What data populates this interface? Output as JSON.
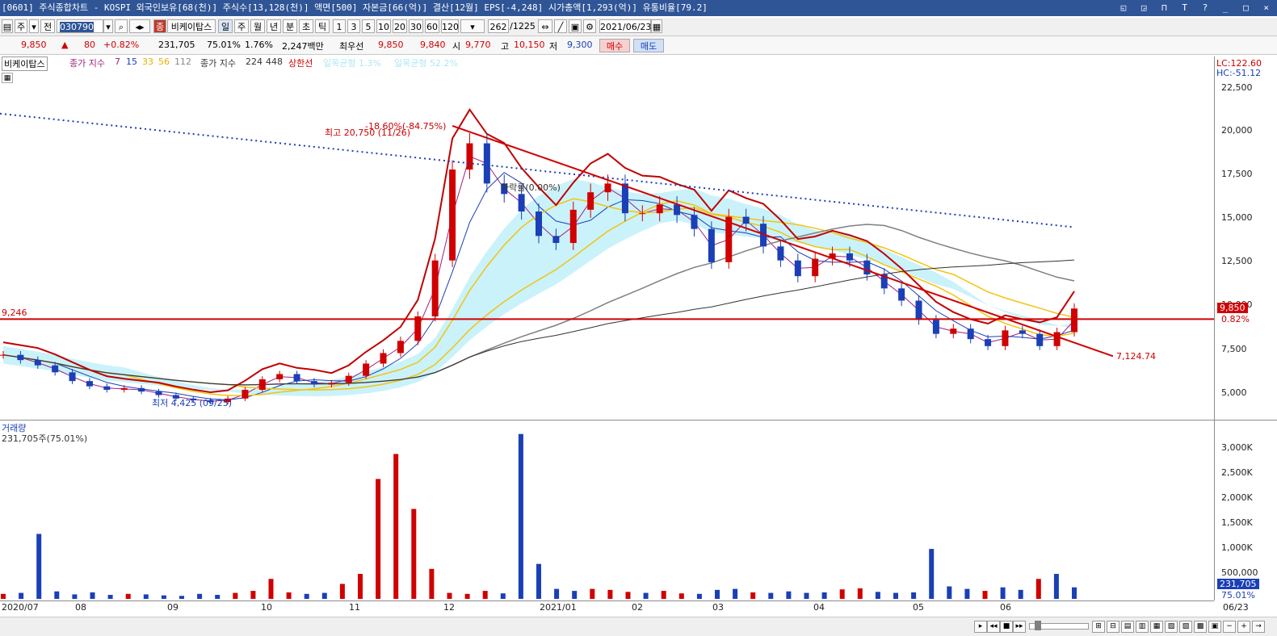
{
  "title": "[0601] 주식종합차트 - KOSPI 외국인보유[68(천)] 주식수[13,128(천)] 액면[500] 자본금[66(억)] 결산[12월] EPS[-4,248] 시가총액[1,293(억)] 유통비율[79.2]",
  "window_buttons": "◱ ◲ ⊓ T ? _ □ ×",
  "toolbar": {
    "code": "030790",
    "period_buttons": [
      "일",
      "주",
      "월",
      "년",
      "분",
      "초",
      "틱"
    ],
    "numbers": [
      "1",
      "3",
      "5",
      "10",
      "20",
      "30",
      "60",
      "120"
    ],
    "indicator": "비케이탑스",
    "count": "262",
    "total": "/1225",
    "date": "2021/06/23",
    "type_label": "종",
    "sub_label": "주",
    "sub2_label": "전"
  },
  "quote": {
    "price": "9,850",
    "arrow": "▲",
    "change": "80",
    "change_pct": "+0.82%",
    "volume": "231,705",
    "vol_pct": "75.01%",
    "turnover": "1.76%",
    "amount": "2,247백만",
    "best_label": "최우선",
    "ask": "9,850",
    "bid": "9,840",
    "open_label": "시",
    "open": "9,770",
    "high_label": "고",
    "high": "10,150",
    "low_label": "저",
    "low": "9,300",
    "buy": "매수",
    "sell": "매도"
  },
  "legend": {
    "name": "비케이탑스",
    "ma_label": "종가 지수",
    "ma": [
      "7",
      "15",
      "33",
      "56",
      "112"
    ],
    "ma2_label": "종가 지수",
    "ma2": [
      "224",
      "448"
    ],
    "limit": "상한선",
    "extra1": "일목균형 1.3%",
    "extra2": "일목균형 52.2%"
  },
  "right_axis": {
    "lc": "LC:122.60",
    "hc": "HC:-51.12",
    "ticks": [
      "22,500",
      "20,000",
      "17,500",
      "15,000",
      "12,500",
      "10,000",
      "7,500",
      "5,000"
    ],
    "price_tag": "9,850",
    "pct_tag": "0.82%",
    "vol_ticks": [
      "3,000K",
      "2,500K",
      "2,000K",
      "1,500K",
      "1,000K",
      "500,000"
    ],
    "vol_tag": "231,705",
    "vol_pct_tag": "75.01%"
  },
  "annotations": {
    "high": "최고 20,750 (11/26)",
    "high_pct": "-18.60%(-84.75%)",
    "low": "최저 4,425 (09/25)",
    "hline": "9,246",
    "trend": "7,124.74",
    "drop": "하락률(0.00%)"
  },
  "volume_pane": {
    "title": "거래량",
    "value": "231,705주(75.01%)"
  },
  "x_axis": [
    "2020/07",
    "08",
    "09",
    "10",
    "11",
    "12",
    "2021/01",
    "02",
    "03",
    "04",
    "05",
    "06"
  ],
  "x_end": "06/23",
  "colors": {
    "up": "#d00000",
    "down": "#1a3fb7",
    "ma_yellow": "#f2c40f",
    "ma_gray": "#7f7f7f",
    "cloud": "#9fe8f5"
  },
  "chart_data": {
    "type": "candlestick",
    "title": "비케이탑스",
    "ylim": [
      3500,
      23500
    ],
    "close_approx": [
      7200,
      6900,
      6600,
      6200,
      5700,
      5400,
      5200,
      5300,
      5100,
      4900,
      4700,
      4600,
      4500,
      4700,
      5200,
      5800,
      6100,
      5700,
      5500,
      5600,
      6000,
      6700,
      7300,
      8000,
      9400,
      12600,
      17800,
      19300,
      17000,
      16400,
      15400,
      14000,
      13600,
      15500,
      16500,
      17000,
      15300,
      15300,
      15800,
      15200,
      14400,
      12500,
      15100,
      14700,
      13400,
      12600,
      11700,
      12700,
      13000,
      12600,
      11800,
      11000,
      10300,
      9200,
      8400,
      8700,
      8100,
      7700,
      8600,
      8400,
      7700,
      8500,
      9850
    ],
    "volume_k_approx": [
      100,
      120,
      1300,
      150,
      90,
      130,
      80,
      100,
      90,
      70,
      60,
      100,
      80,
      120,
      160,
      400,
      130,
      100,
      120,
      300,
      500,
      2400,
      2900,
      1800,
      600,
      120,
      100,
      160,
      110,
      3300,
      700,
      200,
      160,
      200,
      180,
      140,
      120,
      160,
      110,
      100,
      180,
      200,
      130,
      120,
      150,
      120,
      130,
      190,
      210,
      140,
      120,
      130,
      1000,
      250,
      200,
      160,
      230,
      180,
      400,
      500,
      231
    ]
  }
}
